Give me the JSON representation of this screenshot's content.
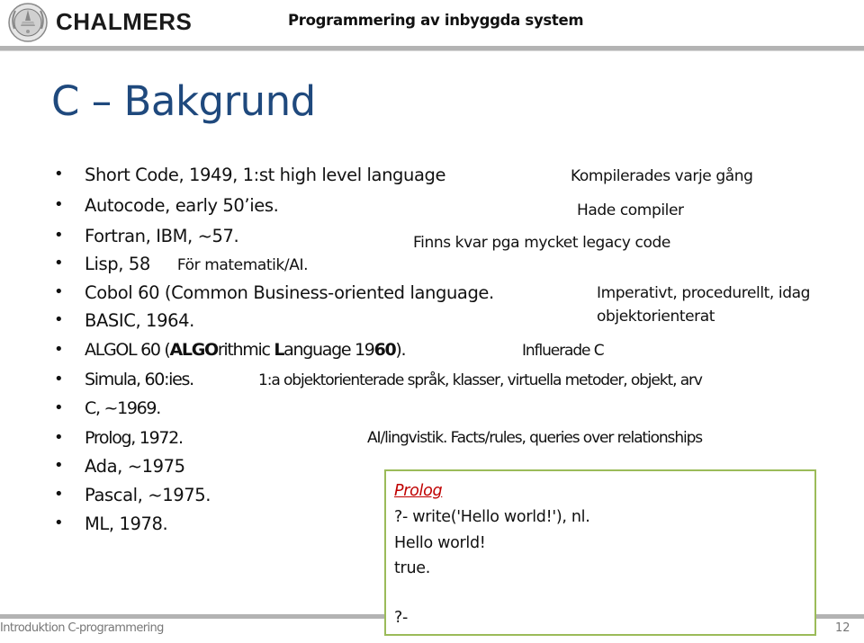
{
  "header": {
    "logo_text": "CHALMERS",
    "logo_icon": "university-seal-icon",
    "course_title": "Programmering av inbyggda system"
  },
  "slide": {
    "title": "C – Bakgrund",
    "bullets": [
      {
        "text": "Short Code, 1949, 1:st high level language"
      },
      {
        "text": "Autocode, early 50’ies."
      },
      {
        "text": "Fortran, IBM, ~57."
      },
      {
        "text": "Lisp, 58",
        "inline_note": "För matematik/AI."
      },
      {
        "text": "Cobol 60 (Common Business-oriented language."
      },
      {
        "text": "BASIC, 1964."
      },
      {
        "text_parts": [
          "ALGOL 60 (",
          "ALGO",
          "rithmic ",
          "L",
          "anguage 19",
          "60",
          ")."
        ]
      },
      {
        "text": "Simula, 60:ies."
      },
      {
        "text": "C, ~1969."
      },
      {
        "text": "Prolog, 1972."
      },
      {
        "text": "Ada, ~1975"
      },
      {
        "text": "Pascal, ~1975."
      },
      {
        "text": "ML, 1978."
      }
    ],
    "notes": {
      "short_code": "Kompilerades varje gång",
      "autocode": "Hade compiler",
      "fortran": "Finns kvar pga mycket legacy code",
      "cobol_line1": "Imperativt, procedurellt, idag",
      "cobol_line2": "objektorienterat",
      "algol": "Influerade C",
      "simula": "1:a objektorienterade språk, klasser, virtuella metoder, objekt, arv",
      "prolog": "AI/lingvistik. Facts/rules, queries over relationships"
    },
    "prolog_box": {
      "heading": "Prolog",
      "lines": [
        "?- write('Hello world!'), nl.",
        "Hello world!",
        "true.",
        "",
        "?-"
      ],
      "border_color": "#9bbb59",
      "heading_color": "#c00000"
    }
  },
  "footer": {
    "left_text": "Introduktion C-programmering",
    "page_number": "12"
  },
  "colors": {
    "title": "#1f497d",
    "rule": "#b3b3b3",
    "footer_text": "#777777"
  }
}
